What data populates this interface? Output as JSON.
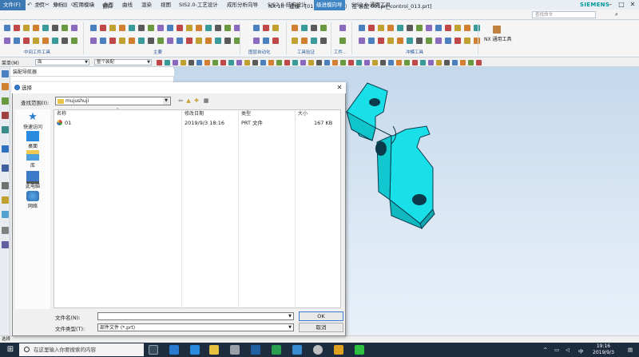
{
  "titlebar": {
    "logo": "NX",
    "window_menu": "窗口",
    "title": "NX 10 - 建模 - [01.prt （修改的） 在 装配 001prj_control_013.prt]",
    "brand": "SIEMENS",
    "min": "–",
    "max": "□",
    "close": "✕"
  },
  "tabs": {
    "file": "文件(F)",
    "items": [
      "主页",
      "分析",
      "应用模块",
      "曲面",
      "曲线",
      "渲染",
      "视图",
      "SIS2.0-工艺设计",
      "成形分析向导",
      "SIS2.0-结构设计"
    ],
    "active": "级进模向导",
    "last": "SIS2.0-通用工具",
    "search_placeholder": "查找命令"
  },
  "ribbon": {
    "groups": [
      "中间工件工具",
      "主要",
      "图层自动化",
      "工具验证",
      "工件...",
      "冲模工具"
    ],
    "nx_tools": "NX 通用工具"
  },
  "toolbar2": {
    "menu": "菜单(M)",
    "filter": "面",
    "scope": "整个装配"
  },
  "navigator": {
    "title": "装配导航器"
  },
  "statusbar": {
    "text": "选择"
  },
  "dialog": {
    "title": "选择",
    "lookin_label": "查找范围(I):",
    "lookin_value": "mujushuji",
    "places": [
      "快速访问",
      "桌面",
      "库",
      "此电脑",
      "网络"
    ],
    "columns": [
      "名称",
      "修改日期",
      "类型",
      "大小"
    ],
    "files": [
      {
        "name": "01",
        "date": "2019/9/3 18:16",
        "type": "PRT 文件",
        "size": "167 KB"
      }
    ],
    "filename_label": "文件名(N):",
    "filename_value": "",
    "filetype_label": "文件类型(T):",
    "filetype_value": "部件文件 (*.prt)",
    "ok": "OK",
    "cancel": "取消"
  },
  "taskbar": {
    "search_placeholder": "在这里输入你要搜索的内容",
    "time": "19:16",
    "date": "2019/9/3",
    "lang": "中"
  }
}
